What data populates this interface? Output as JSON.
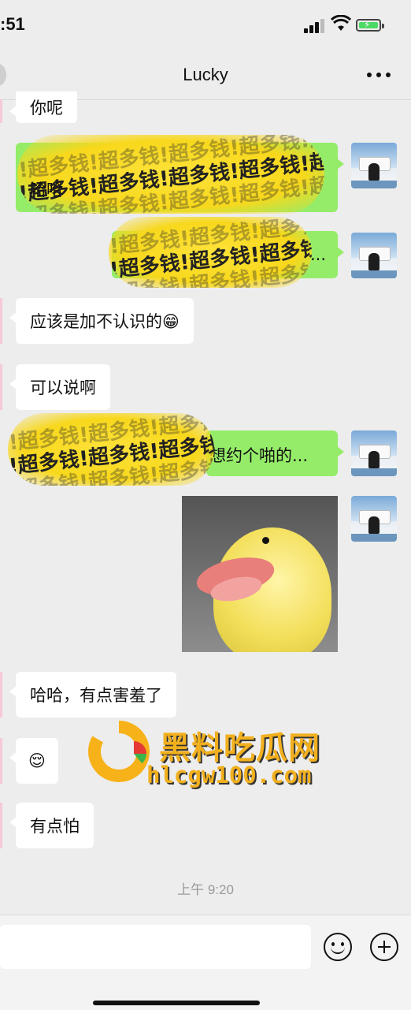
{
  "status_bar": {
    "time": ":51"
  },
  "header": {
    "title": "Lucky"
  },
  "messages": {
    "m0": {
      "text": "你呢"
    },
    "m1": {
      "sticker_text": "!超多钱!超多钱!超多钱!超多钱!超多钱!超多钱!",
      "text": "哈哈"
    },
    "m2": {
      "sticker_text": "!超多钱!超多钱!超多钱!超多钱!",
      "text": "..."
    },
    "m3": {
      "text": "应该是加不认识的😁"
    },
    "m4": {
      "text": "可以说啊"
    },
    "m5": {
      "sticker_text": "!超多钱!超多钱!超多钱!超多钱!",
      "text": "想约个啪的..."
    },
    "m7": {
      "text": "哈哈，有点害羞了"
    },
    "m8": {
      "text": "😌"
    },
    "m9": {
      "text": "有点怕"
    }
  },
  "timestamp": "上午 9:20",
  "watermark": {
    "name": "黑料吃瓜网",
    "url": "hlcgw100.com"
  },
  "colors": {
    "bubble_sent": "#95ec69",
    "bubble_received": "#ffffff",
    "background": "#ededed"
  }
}
